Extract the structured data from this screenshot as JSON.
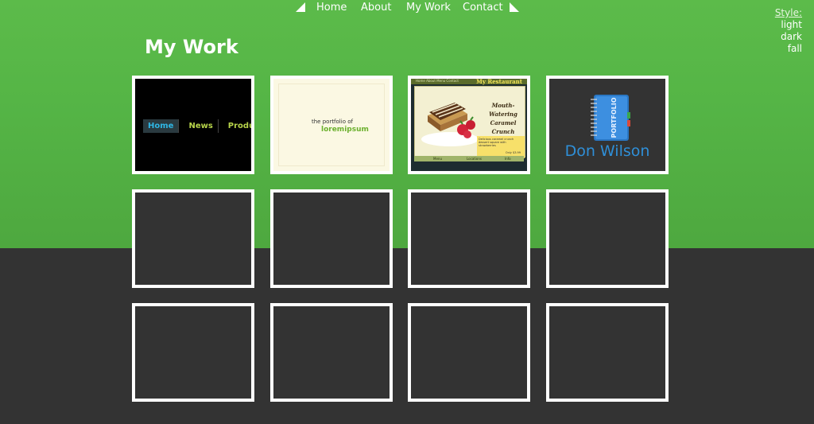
{
  "nav": {
    "items": [
      {
        "label": "Home"
      },
      {
        "label": "About"
      },
      {
        "label": "My Work"
      },
      {
        "label": "Contact"
      }
    ]
  },
  "style_switcher": {
    "label": "Style:",
    "options": [
      "light",
      "dark",
      "fall"
    ]
  },
  "page": {
    "title": "My Work"
  },
  "portfolio": {
    "thumb1": {
      "nav_items": [
        "Home",
        "News",
        "Produ"
      ]
    },
    "thumb2": {
      "line1": "the portfolio of",
      "line2": "loremipsum"
    },
    "thumb3": {
      "brand": "My Restaurant",
      "menu": "Home  About  Menu  Contact",
      "headline_1": "Mouth-Watering",
      "headline_2": "Caramel Crunch",
      "note": "Delicious caramel crunch dessert square with strawberries",
      "price": "Only $3.99",
      "footer": [
        "Menu",
        "Locations",
        "Info"
      ]
    },
    "thumb4": {
      "book_label": "PORTFOLIO",
      "name": "Don Wilson"
    }
  },
  "colors": {
    "band_green": "#55b546",
    "background_dark": "#333333",
    "tile_border": "#ffffff",
    "don_wilson_blue": "#2f8fd8"
  }
}
